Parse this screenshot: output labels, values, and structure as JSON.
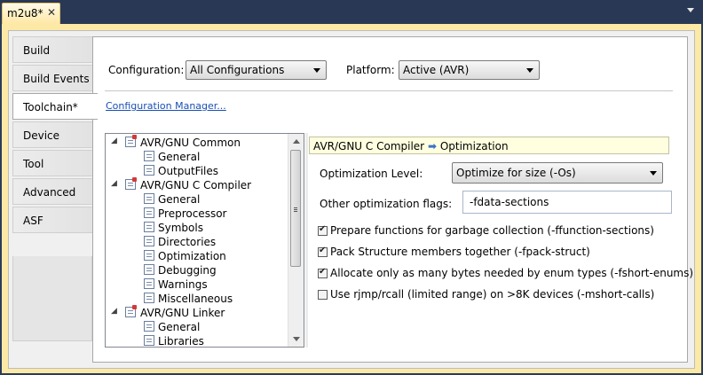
{
  "document_tab": {
    "title": "m2u8*",
    "close_glyph": "✕"
  },
  "side_tabs": [
    "Build",
    "Build Events",
    "Toolchain*",
    "Device",
    "Tool",
    "Advanced",
    "ASF"
  ],
  "active_side_tab": "Toolchain*",
  "configuration": {
    "label": "Configuration:",
    "value": "All Configurations"
  },
  "platform": {
    "label": "Platform:",
    "value": "Active (AVR)"
  },
  "config_manager_link": "Configuration Manager...",
  "tree": [
    {
      "text": "AVR/GNU Common",
      "level": 0,
      "expander": "◢",
      "icon": "property-page-icon"
    },
    {
      "text": "General",
      "level": 1,
      "icon": "page-icon"
    },
    {
      "text": "OutputFiles",
      "level": 1,
      "icon": "page-icon"
    },
    {
      "text": "AVR/GNU C Compiler",
      "level": 0,
      "expander": "◢",
      "icon": "property-page-icon"
    },
    {
      "text": "General",
      "level": 1,
      "icon": "page-icon"
    },
    {
      "text": "Preprocessor",
      "level": 1,
      "icon": "page-icon"
    },
    {
      "text": "Symbols",
      "level": 1,
      "icon": "page-icon"
    },
    {
      "text": "Directories",
      "level": 1,
      "icon": "page-icon"
    },
    {
      "text": "Optimization",
      "level": 1,
      "icon": "page-icon"
    },
    {
      "text": "Debugging",
      "level": 1,
      "icon": "page-icon"
    },
    {
      "text": "Warnings",
      "level": 1,
      "icon": "page-icon"
    },
    {
      "text": "Miscellaneous",
      "level": 1,
      "icon": "page-icon"
    },
    {
      "text": "AVR/GNU Linker",
      "level": 0,
      "expander": "◢",
      "icon": "property-page-icon"
    },
    {
      "text": "General",
      "level": 1,
      "icon": "page-icon"
    },
    {
      "text": "Libraries",
      "level": 1,
      "icon": "page-icon"
    }
  ],
  "page_header": {
    "section": "AVR/GNU C Compiler",
    "arrow": "➡",
    "page": "Optimization"
  },
  "optimization_level": {
    "label": "Optimization Level:",
    "value": "Optimize for size (-Os)"
  },
  "other_flags": {
    "label": "Other optimization flags:",
    "value": "-fdata-sections"
  },
  "checkboxes": [
    {
      "label": "Prepare functions for garbage collection (-ffunction-sections)",
      "checked": true
    },
    {
      "label": "Pack Structure members together (-fpack-struct)",
      "checked": true
    },
    {
      "label": "Allocate only as many bytes needed by enum types (-fshort-enums)",
      "checked": true
    },
    {
      "label": "Use rjmp/rcall (limited range) on >8K devices (-mshort-calls)",
      "checked": false
    }
  ],
  "check_glyph": "✔"
}
